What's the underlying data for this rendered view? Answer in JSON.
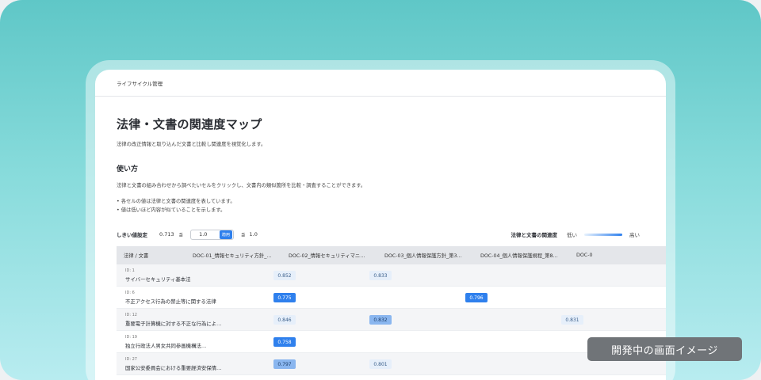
{
  "nav": {
    "section": "ライフサイクル管理"
  },
  "page": {
    "title": "法律・文書の関連度マップ",
    "subtitle": "法律の改正情報と取り込んだ文書と比較し関連度を視覚化します。"
  },
  "howto": {
    "title": "使い方",
    "description": "法律と文書の組み合わせから調べたいセルをクリックし、文書内の類似箇所を比較・調査することができます。",
    "bullets": [
      "各セルの値は法律と文書の関連度を表しています。",
      "値は低いほど内容が似ていることを示します。"
    ]
  },
  "threshold": {
    "label": "しきい値設定",
    "min": "0.713",
    "leq": "≦",
    "value": "1.0",
    "apply_label": "適用",
    "max": "1.0"
  },
  "legend": {
    "title": "法律と文書の関連度",
    "low": "低い",
    "high": "高い",
    "low_color": "#e8f2fd",
    "high_color": "#2f80ed"
  },
  "matrix": {
    "corner_label": "法律 / 文書",
    "columns": [
      "DOC-01_情報セキュリティ方針_…",
      "DOC-02_情報セキュリティマニ…",
      "DOC-03_個人情報保護方針_第3…",
      "DOC-04_個人情報保護規程_第8…",
      "DOC-0"
    ],
    "rows": [
      {
        "id": "ID: 1",
        "name": "サイバーセキュリティ基本法",
        "cells": [
          {
            "value": "0.852",
            "level": 1
          },
          {
            "value": "0.833",
            "level": 1
          },
          null,
          null,
          null
        ]
      },
      {
        "id": "ID: 6",
        "name": "不正アクセス行為の禁止等に関する法律",
        "cells": [
          {
            "value": "0.775",
            "level": 3
          },
          null,
          {
            "value": "0.796",
            "level": 3
          },
          null,
          null
        ]
      },
      {
        "id": "ID: 12",
        "name": "重要電子計算機に対する不正な行為によ…",
        "cells": [
          {
            "value": "0.846",
            "level": 1
          },
          {
            "value": "0.832",
            "level": 2
          },
          null,
          {
            "value": "0.831",
            "level": 1
          },
          null
        ]
      },
      {
        "id": "ID: 19",
        "name": "独立行政法人男女共同参画機構法…",
        "cells": [
          {
            "value": "0.758",
            "level": 3
          },
          null,
          null,
          null,
          null
        ]
      },
      {
        "id": "ID: 27",
        "name": "国家公安委員会における重要経済安保情…",
        "cells": [
          {
            "value": "0.797",
            "level": 2
          },
          {
            "value": "0.801",
            "level": 1
          },
          null,
          null,
          null
        ]
      }
    ]
  },
  "badge": {
    "label": "開発中の画面イメージ"
  }
}
